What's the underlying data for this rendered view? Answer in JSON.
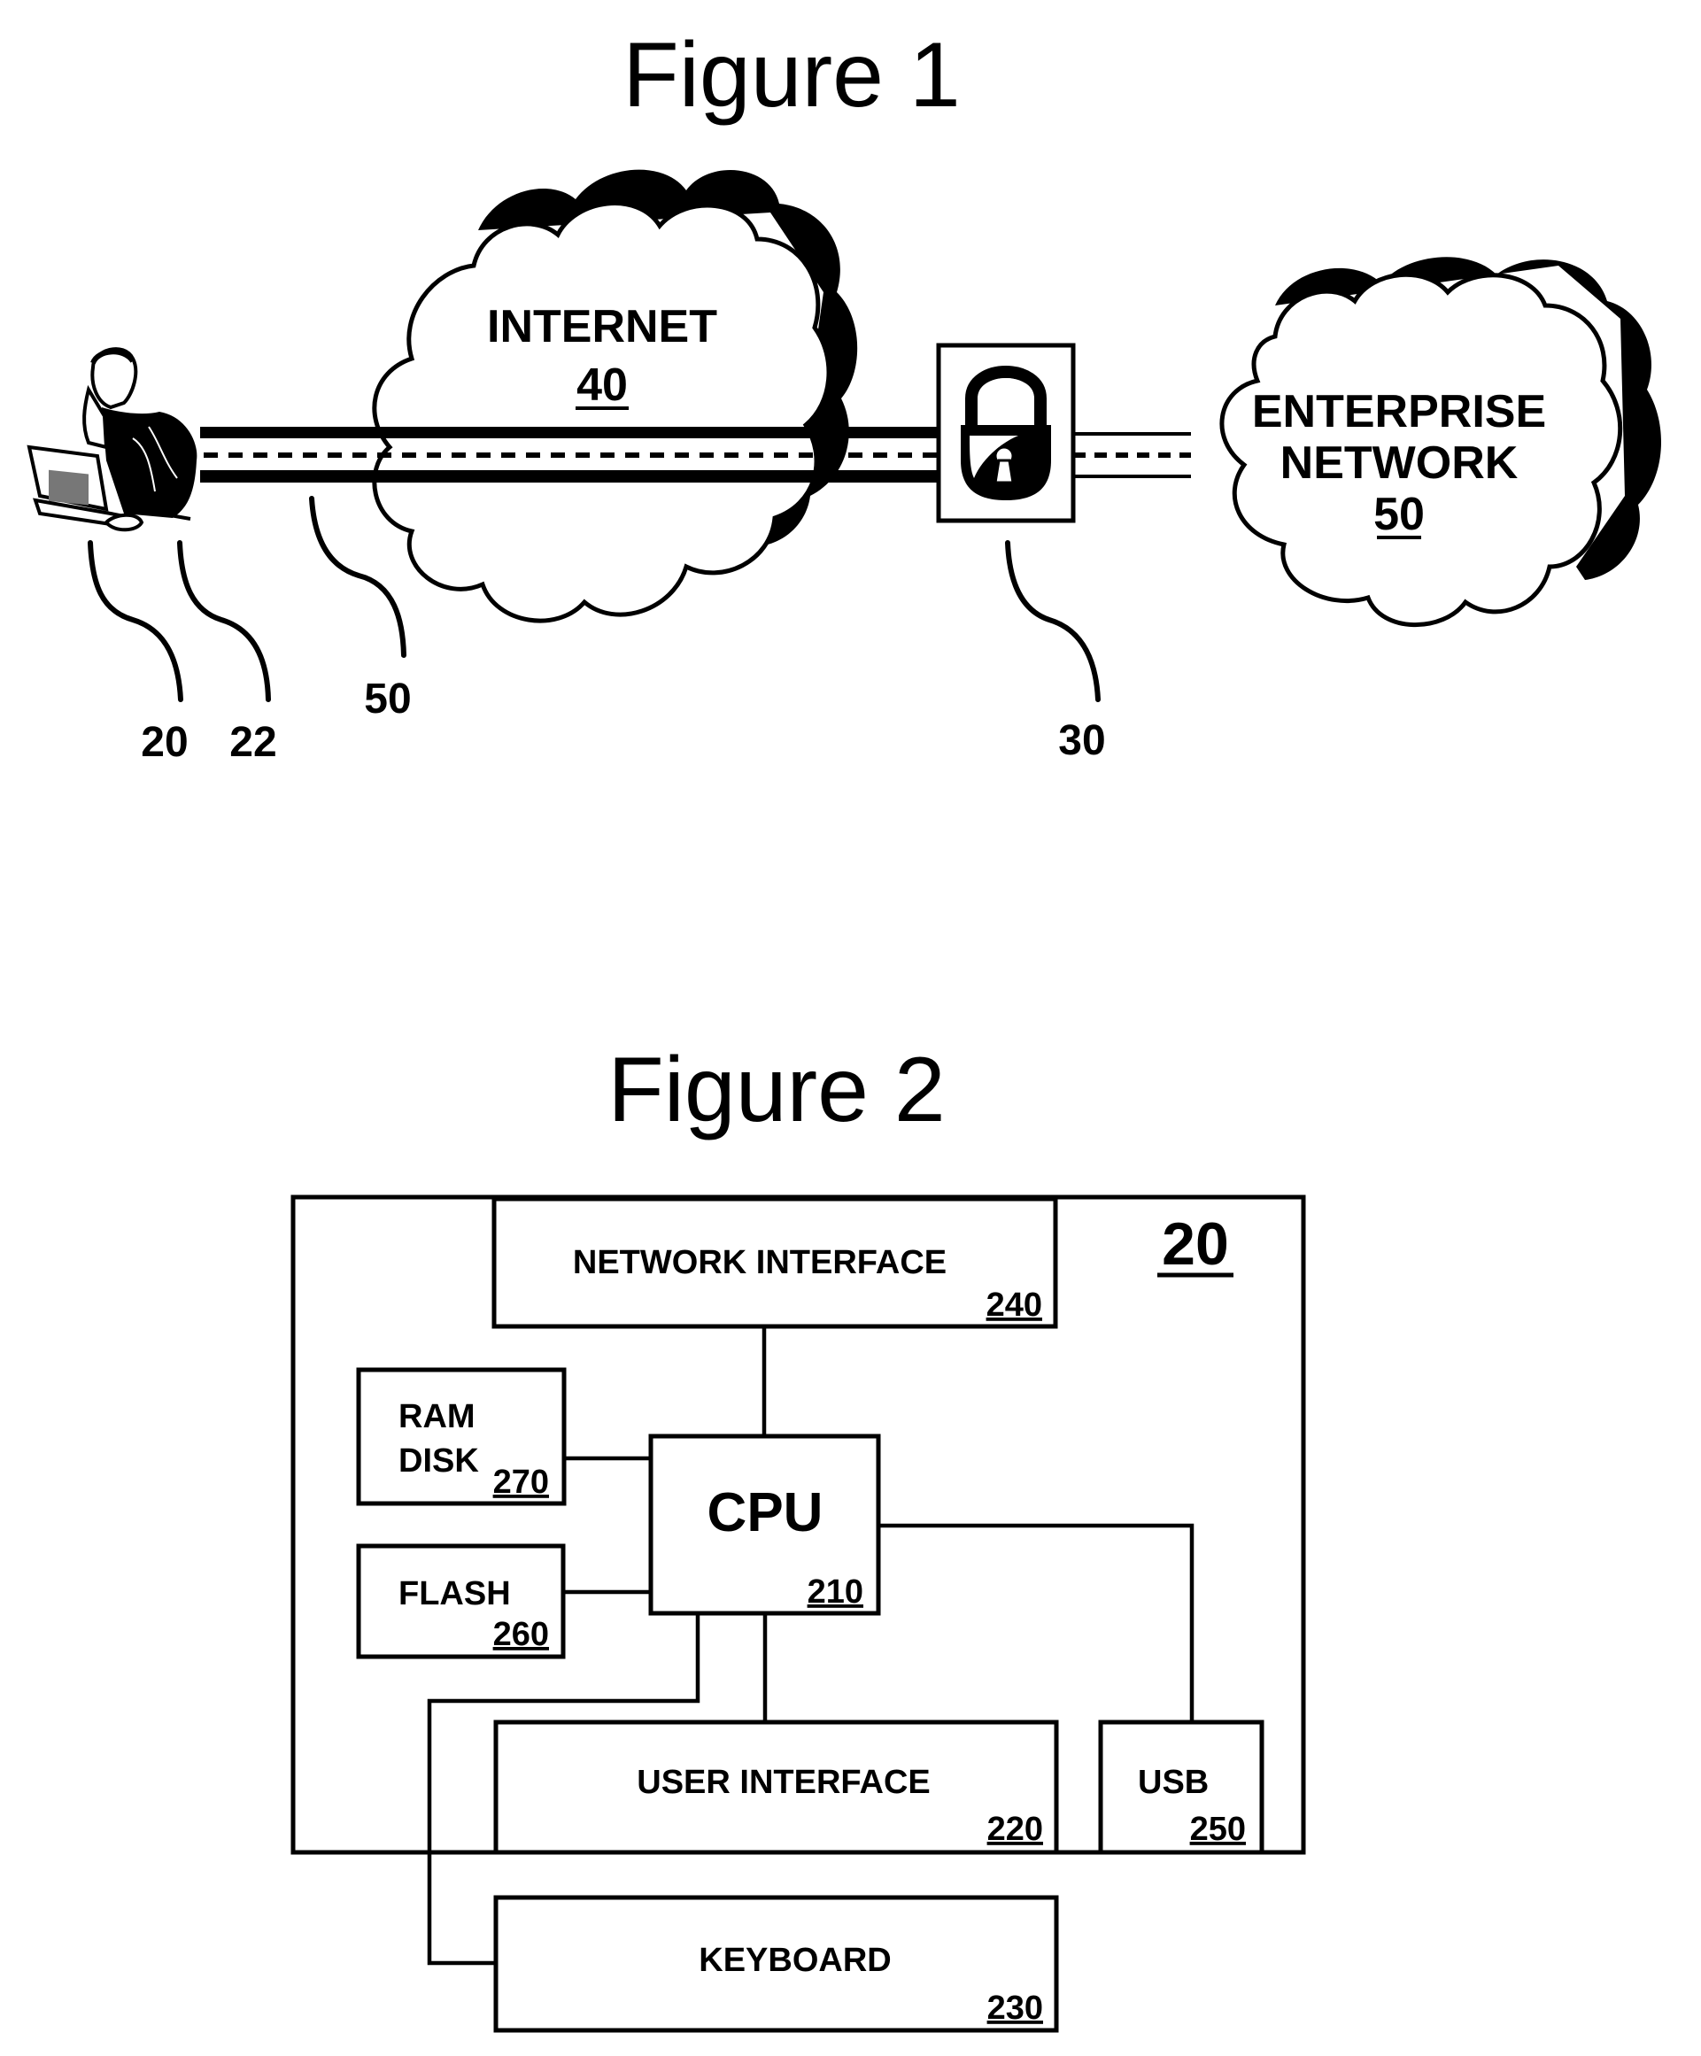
{
  "figure1": {
    "title": "Figure 1",
    "internet_cloud": {
      "label": "INTERNET",
      "ref": "40"
    },
    "enterprise_cloud": {
      "label_line1": "ENTERPRISE",
      "label_line2": "NETWORK",
      "ref": "50"
    },
    "icons": {
      "user": "user-at-laptop-icon",
      "gateway": "padlock-icon"
    },
    "reference_labels": [
      {
        "id": "user",
        "text": "20"
      },
      {
        "id": "laptop",
        "text": "22"
      },
      {
        "id": "tunnel",
        "text": "50"
      },
      {
        "id": "gateway",
        "text": "30"
      }
    ]
  },
  "figure2": {
    "title": "Figure 2",
    "system_ref": "20",
    "blocks": {
      "network_interface": {
        "label": "NETWORK INTERFACE",
        "ref": "240"
      },
      "ram_disk": {
        "label_line1": "RAM",
        "label_line2": "DISK",
        "ref": "270"
      },
      "cpu": {
        "label": "CPU",
        "ref": "210"
      },
      "flash": {
        "label": "FLASH",
        "ref": "260"
      },
      "user_interface": {
        "label": "USER INTERFACE",
        "ref": "220"
      },
      "usb": {
        "label": "USB",
        "ref": "250"
      },
      "keyboard": {
        "label": "KEYBOARD",
        "ref": "230"
      }
    }
  }
}
